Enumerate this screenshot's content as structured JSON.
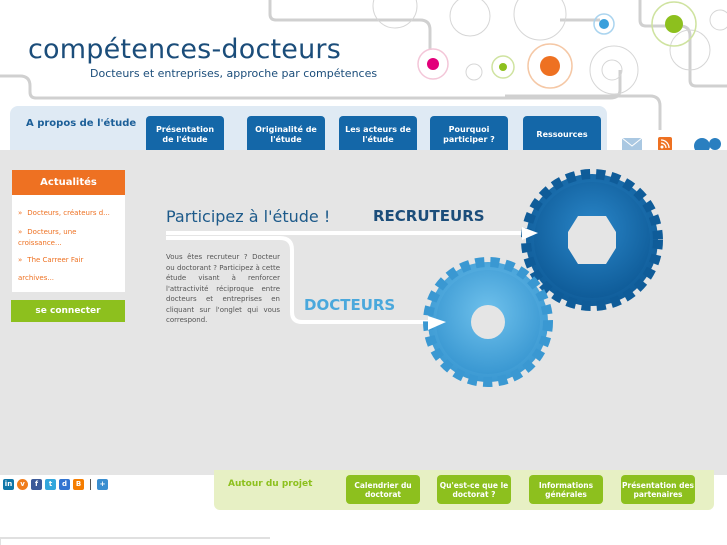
{
  "header": {
    "logo": "compétences-docteurs",
    "tagline": "Docteurs et entreprises, approche par compétences"
  },
  "nav": {
    "about": "A propos de l'étude",
    "items": [
      {
        "label": "Présentation de l'étude"
      },
      {
        "label": "Originalité de l'étude"
      },
      {
        "label": "Les acteurs de l'étude"
      },
      {
        "label": "Pourquoi participer ?"
      },
      {
        "label": "Ressources"
      }
    ]
  },
  "sidebar": {
    "news_title": "Actualités",
    "news": [
      {
        "text": "Docteurs, créateurs d..."
      },
      {
        "text": "Docteurs, une croissance..."
      },
      {
        "text": "The Carreer Fair"
      }
    ],
    "archives": "archives...",
    "connect": "se connecter"
  },
  "main": {
    "title": "Participez à l'étude !",
    "recruiters": "RECRUTEURS",
    "doctors": "DOCTEURS",
    "body": "Vous êtes recruteur ? Docteur ou doctorant ? Participez à cette étude visant à renforcer l'attractivité réciproque entre docteurs et entreprises en cliquant sur l'onglet qui vous correspond."
  },
  "footer": {
    "about": "Autour du projet",
    "items": [
      {
        "label": "Calendrier du doctorat"
      },
      {
        "label": "Qu'est-ce que le doctorat ?"
      },
      {
        "label": "Informations générales"
      },
      {
        "label": "Présentation des partenaires"
      }
    ]
  },
  "social": {
    "icons": [
      "linkedin-icon",
      "viadeo-icon",
      "facebook-icon",
      "twitter-icon",
      "delicious-icon",
      "blogger-icon",
      "share-icon"
    ]
  },
  "colors": {
    "primary": "#1467a8",
    "orange": "#ee7122",
    "green": "#8dc01e",
    "gear_dark": "#1a6fb0",
    "gear_light": "#4aa8dc"
  }
}
